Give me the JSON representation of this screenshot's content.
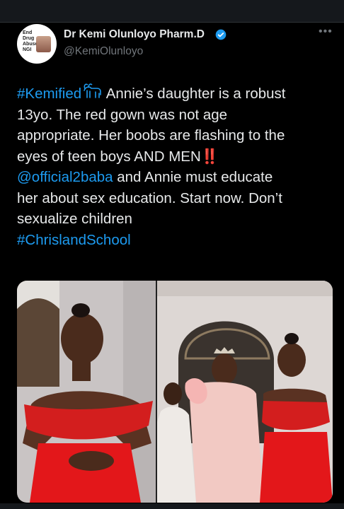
{
  "tweet": {
    "author_name": "Dr Kemi Olunloyo Pharm.D",
    "handle": "@KemiOlunloyo",
    "verified": true,
    "avatar_text": [
      "End",
      "Drug",
      "Abuse",
      "NGI"
    ],
    "more_label": "•••",
    "lines": [
      {
        "hashtag": "#Kemified",
        "emoji": "goat",
        "text": " Annie’s daughter is a robust"
      },
      {
        "text": "13yo. The red gown was not age"
      },
      {
        "text": "appropriate. Her boobs are flashing to the"
      },
      {
        "text": "eyes of teen boys AND MEN",
        "emoji_end": "‼️"
      },
      {
        "mention": "@official2baba",
        "text": " and Annie must educate"
      },
      {
        "text": "her about sex education. Start now. Don’t"
      },
      {
        "text": "sexualize children"
      },
      {
        "hashtag": "#ChrislandSchool"
      }
    ],
    "media": [
      {
        "name": "photo-girl-red-gown",
        "description_icon": "photo"
      },
      {
        "name": "photo-family-group",
        "description_icon": "photo"
      }
    ]
  },
  "colors": {
    "background": "#000000",
    "text": "#e7e9ea",
    "secondary": "#71767b",
    "link": "#1d9bf0",
    "verified": "#1d9bf0",
    "alert": "#f4212e"
  }
}
